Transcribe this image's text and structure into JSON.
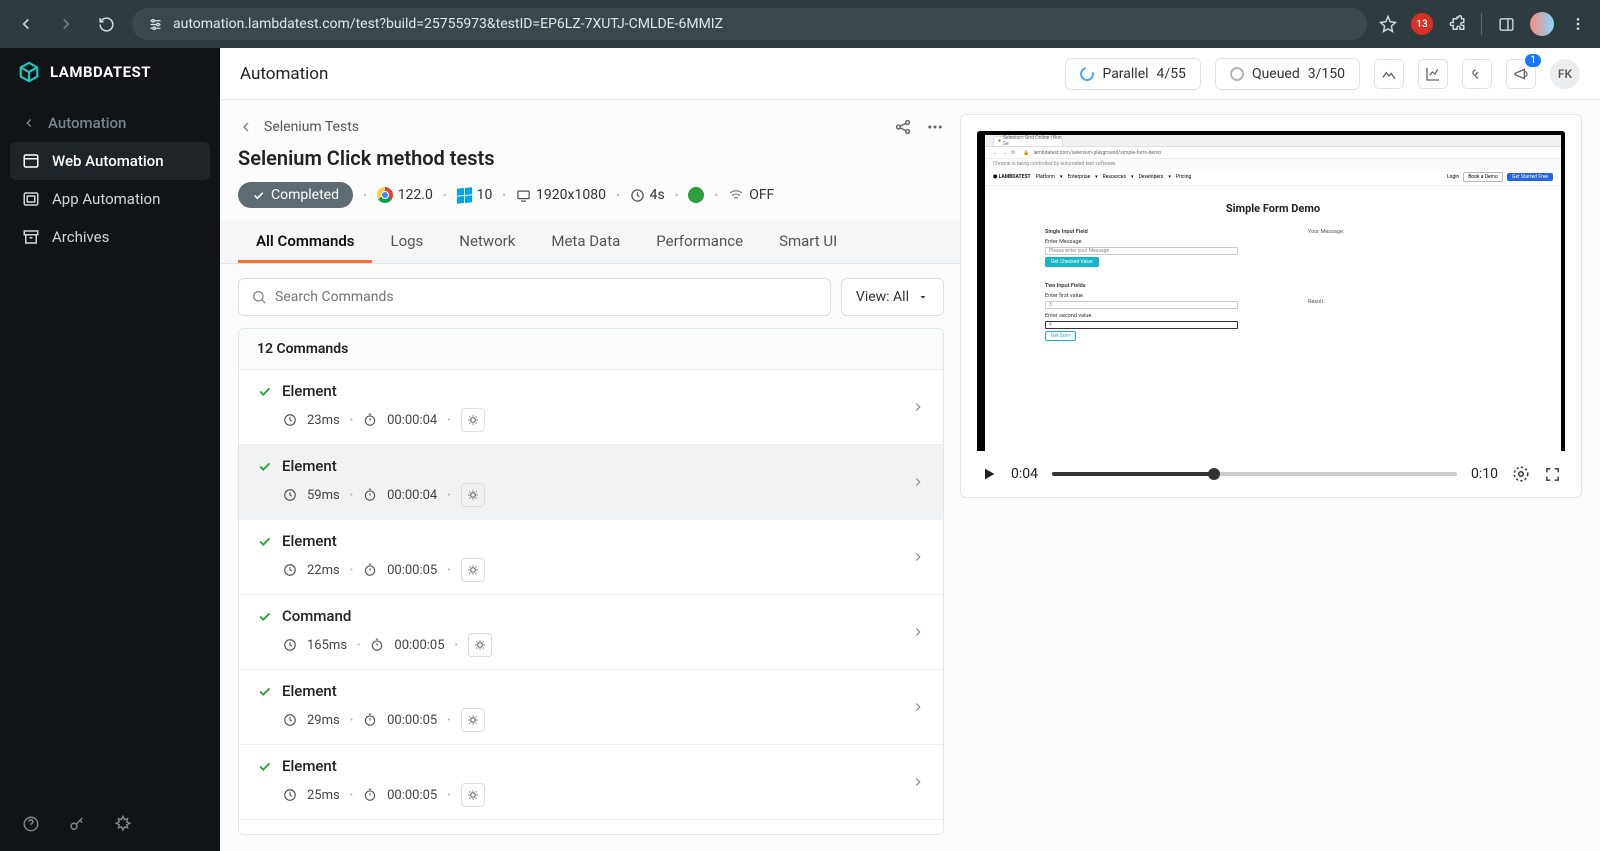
{
  "browser": {
    "url": "automation.lambdatest.com/test?build=25755973&testID=EP6LZ-7XUTJ-CMLDE-6MMIZ",
    "ext_badge": "13"
  },
  "sidebar": {
    "brand": "LAMBDATEST",
    "back_label": "Automation",
    "items": [
      "Web Automation",
      "App Automation",
      "Archives"
    ]
  },
  "topbar": {
    "title": "Automation",
    "parallel_label": "Parallel",
    "parallel_value": "4/55",
    "queued_label": "Queued",
    "queued_value": "3/150",
    "notif_badge": "1",
    "user_initials": "FK"
  },
  "header": {
    "breadcrumb": "Selenium Tests",
    "title": "Selenium Click method tests",
    "status": "Completed",
    "chrome_ver": "122.0",
    "os_ver": "10",
    "resolution": "1920x1080",
    "duration": "4s",
    "net": "OFF"
  },
  "tabs": [
    "All Commands",
    "Logs",
    "Network",
    "Meta Data",
    "Performance",
    "Smart UI"
  ],
  "search": {
    "placeholder": "Search Commands",
    "view": "View: All"
  },
  "commands": {
    "count_label": "12 Commands",
    "items": [
      {
        "name": "Element",
        "dur": "23ms",
        "ts": "00:00:04"
      },
      {
        "name": "Element",
        "dur": "59ms",
        "ts": "00:00:04"
      },
      {
        "name": "Element",
        "dur": "22ms",
        "ts": "00:00:05"
      },
      {
        "name": "Command",
        "dur": "165ms",
        "ts": "00:00:05"
      },
      {
        "name": "Element",
        "dur": "29ms",
        "ts": "00:00:05"
      },
      {
        "name": "Element",
        "dur": "25ms",
        "ts": "00:00:05"
      }
    ]
  },
  "video": {
    "page_title": "Simple Form Demo",
    "section1": "Single Input Field",
    "enter_msg": "Enter Message",
    "placeholder1": "Please enter your Message",
    "btn1": "Get Checked Value",
    "your_msg": "Your Message:",
    "section2": "Two Input Fields",
    "enter_first": "Enter first value",
    "enter_second": "Enter second value",
    "val1": "3",
    "val2": "4",
    "btn2": "Get Sum",
    "result": "Result:",
    "tab_title": "Selenium Grid Online | Run Se",
    "addr": "lambdatest.com/selenium-playground/simple-form-demo",
    "banner": "Chrome is being controlled by automated test software.",
    "nav_items": [
      "Platform",
      "Enterprise",
      "Resources",
      "Developers",
      "Pricing"
    ],
    "nav_login": "Login",
    "nav_demo": "Book a Demo",
    "nav_start": "Get Started Free",
    "cur": "0:04",
    "total": "0:10"
  }
}
